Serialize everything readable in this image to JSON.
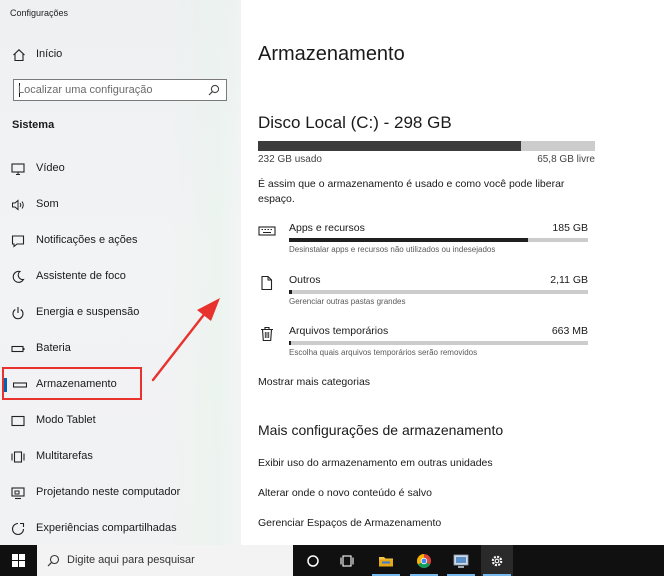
{
  "window": {
    "title": "Configurações"
  },
  "sidebar": {
    "home_label": "Início",
    "search_placeholder": "Localizar uma configuração",
    "section_title": "Sistema",
    "items": [
      {
        "label": "Vídeo",
        "icon": "monitor-icon"
      },
      {
        "label": "Som",
        "icon": "speaker-icon"
      },
      {
        "label": "Notificações e ações",
        "icon": "notification-icon"
      },
      {
        "label": "Assistente de foco",
        "icon": "moon-icon"
      },
      {
        "label": "Energia e suspensão",
        "icon": "power-icon"
      },
      {
        "label": "Bateria",
        "icon": "battery-icon"
      },
      {
        "label": "Armazenamento",
        "icon": "storage-icon",
        "active": true
      },
      {
        "label": "Modo Tablet",
        "icon": "tablet-icon"
      },
      {
        "label": "Multitarefas",
        "icon": "multitask-icon"
      },
      {
        "label": "Projetando neste computador",
        "icon": "projector-icon"
      },
      {
        "label": "Experiências compartilhadas",
        "icon": "shared-icon"
      }
    ]
  },
  "main": {
    "title": "Armazenamento",
    "disk": {
      "name": "Disco Local (C:) - 298 GB",
      "used_label": "232 GB usado",
      "free_label": "65,8 GB livre",
      "used_fraction": 0.78
    },
    "description": "É assim que o armazenamento é usado e como você pode liberar espaço.",
    "categories": [
      {
        "name": "Apps e recursos",
        "size": "185 GB",
        "subtitle": "Desinstalar apps e recursos não utilizados ou indesejados",
        "fraction": 0.8,
        "icon": "keyboard-icon"
      },
      {
        "name": "Outros",
        "size": "2,11 GB",
        "subtitle": "Gerenciar outras pastas grandes",
        "fraction": 0.01,
        "icon": "document-icon"
      },
      {
        "name": "Arquivos temporários",
        "size": "663 MB",
        "subtitle": "Escolha quais arquivos temporários serão removidos",
        "fraction": 0.005,
        "icon": "trash-icon"
      }
    ],
    "more_categories": "Mostrar mais categorias",
    "more_settings_title": "Mais configurações de armazenamento",
    "links": [
      "Exibir uso do armazenamento em outras unidades",
      "Alterar onde o novo conteúdo é salvo",
      "Gerenciar Espaços de Armazenamento"
    ]
  },
  "taskbar": {
    "search_label": "Digite aqui para pesquisar",
    "apps": [
      "cortana-icon",
      "task-view-icon",
      "file-explorer-icon",
      "chrome-icon",
      "control-panel-icon",
      "settings-icon"
    ]
  },
  "colors": {
    "accent": "#0063b1",
    "annotation": "#e8322e",
    "bar_fill": "#3c3c3c",
    "bar_track": "#cccccc"
  }
}
